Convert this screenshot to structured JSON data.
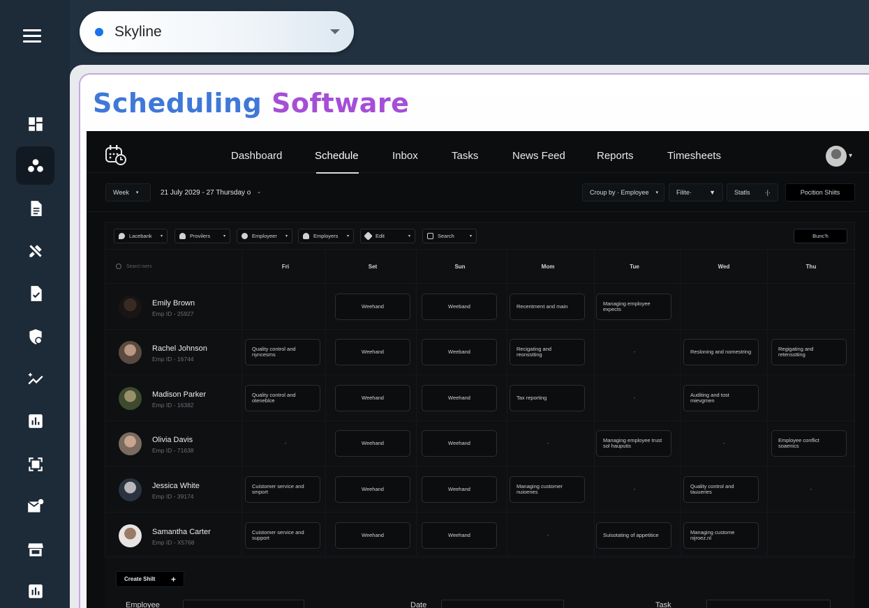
{
  "workspace": {
    "name": "Skyline",
    "dot_color": "#1a73e8"
  },
  "hero": {
    "word1": "Scheduling",
    "word2": "Software"
  },
  "rail": {
    "icons": [
      "dashboard-icon",
      "team-icon",
      "document-icon",
      "tools-icon",
      "task-check-icon",
      "security-icon",
      "analytics-icon",
      "bar-chart-icon",
      "scanner-icon",
      "mail-icon",
      "store-icon",
      "report-icon"
    ]
  },
  "nav": {
    "items": [
      "Dashboard",
      "Schedule",
      "Inbox",
      "Tasks",
      "News Feed",
      "Reports",
      "Timesheets"
    ],
    "active": "Schedule"
  },
  "toolbar": {
    "view": "Week",
    "date_range": "21 July 2029 - 27 Thursday o",
    "date_sep": "-",
    "group_by": "Croup by · Employee",
    "filter": "Filite·",
    "stats": "Statls",
    "position_shifts": "Pocition Shiits"
  },
  "filters": {
    "items": [
      "Lacebank",
      "Provilers",
      "Employeer",
      "Employers",
      "Edit",
      "Search"
    ],
    "bunch": "Bunc'h"
  },
  "grid": {
    "search_placeholder": "Searcl isers",
    "days": [
      "Fri",
      "Set",
      "Sun",
      "Mom",
      "Tue",
      "Wed",
      "Thu"
    ]
  },
  "employees": [
    {
      "name": "Emily Brown",
      "id": "Emp ID - 25927",
      "shifts": [
        "",
        "Weehand",
        "Weeband",
        "Recentment and main",
        "Managing employee expects",
        "",
        ""
      ]
    },
    {
      "name": "Rachel Johnson",
      "id": "Emp ID - 16744",
      "shifts": [
        "Quality control and nyncesms",
        "Weehand",
        "Weeband",
        "Recigating and reonsstting",
        "-",
        "Resloning and nomestring",
        "Regigating and retensstting"
      ]
    },
    {
      "name": "Madison Parker",
      "id": "Emp ID - 16382",
      "shifts": [
        "Quality control and oteneblce",
        "Weehand",
        "Weehand",
        "Tax reporting",
        "-",
        "Auditing and tost mievgmen",
        ""
      ]
    },
    {
      "name": "Olivia Davis",
      "id": "Emp ID - 71638",
      "shifts": [
        "-",
        "Weehand",
        "Weehand",
        "-",
        "Managing employee trust sol hauputis",
        "-",
        "Employee conflict soaenics"
      ]
    },
    {
      "name": "Jessica White",
      "id": "Emp ID - 39174",
      "shifts": [
        "Cuistomer service and smport",
        "Weehand",
        "Weehand",
        "Managing customer nuioenes",
        "-",
        "Quality control and tauueries",
        "-"
      ]
    },
    {
      "name": "Samantha Carter",
      "id": "Emp ID - X5768",
      "shifts": [
        "Cuistomer service and support",
        "Weehand",
        "Weehand",
        "-",
        "Suisotating of appetitice",
        "Managing custome nijroez.nl",
        ""
      ]
    }
  ],
  "create": {
    "label": "Create Shilt",
    "plus": "+"
  },
  "form": {
    "employee": "Employee",
    "date": "Date",
    "task": "Task"
  }
}
